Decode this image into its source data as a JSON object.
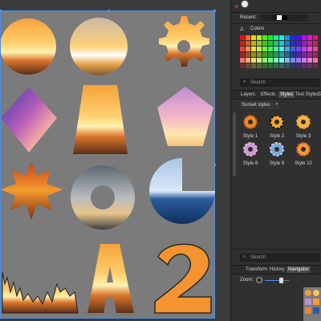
{
  "panel": {
    "recent_label": "Recent:",
    "colors_label": "Colors",
    "search_placeholder": "Search",
    "tabs_top": [
      "Layers",
      "Effects",
      "Styles",
      "Text Styles",
      "S"
    ],
    "active_tab_top": "Styles",
    "style_category": "Sunset styles",
    "styles": [
      {
        "label": "Style 1"
      },
      {
        "label": "Style 2"
      },
      {
        "label": "Style 3"
      },
      {
        "label": "Style 8"
      },
      {
        "label": "Style 9"
      },
      {
        "label": "Style 10"
      }
    ],
    "search2_placeholder": "Search",
    "tabs_bottom": [
      "Transform",
      "History",
      "Navigator"
    ],
    "active_tab_bottom": "Navigator",
    "zoom_label": "Zoom:"
  },
  "colors": {
    "accent": "#4d8fe8",
    "canvas_bg": "#7b7b7b",
    "panel_bg": "#303030"
  }
}
